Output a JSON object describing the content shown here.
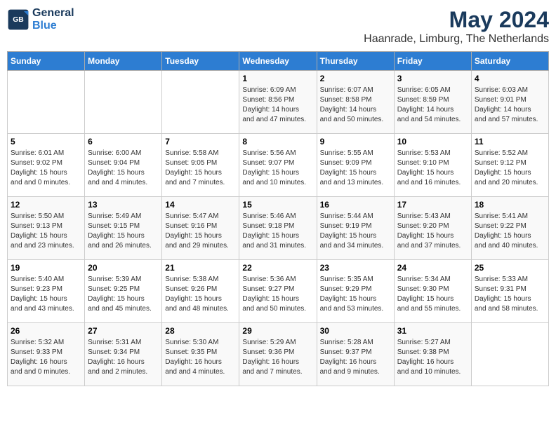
{
  "header": {
    "logo_general": "General",
    "logo_blue": "Blue",
    "month": "May 2024",
    "location": "Haanrade, Limburg, The Netherlands"
  },
  "weekdays": [
    "Sunday",
    "Monday",
    "Tuesday",
    "Wednesday",
    "Thursday",
    "Friday",
    "Saturday"
  ],
  "weeks": [
    [
      {
        "day": "",
        "sunrise": "",
        "sunset": "",
        "daylight": ""
      },
      {
        "day": "",
        "sunrise": "",
        "sunset": "",
        "daylight": ""
      },
      {
        "day": "",
        "sunrise": "",
        "sunset": "",
        "daylight": ""
      },
      {
        "day": "1",
        "sunrise": "Sunrise: 6:09 AM",
        "sunset": "Sunset: 8:56 PM",
        "daylight": "Daylight: 14 hours and 47 minutes."
      },
      {
        "day": "2",
        "sunrise": "Sunrise: 6:07 AM",
        "sunset": "Sunset: 8:58 PM",
        "daylight": "Daylight: 14 hours and 50 minutes."
      },
      {
        "day": "3",
        "sunrise": "Sunrise: 6:05 AM",
        "sunset": "Sunset: 8:59 PM",
        "daylight": "Daylight: 14 hours and 54 minutes."
      },
      {
        "day": "4",
        "sunrise": "Sunrise: 6:03 AM",
        "sunset": "Sunset: 9:01 PM",
        "daylight": "Daylight: 14 hours and 57 minutes."
      }
    ],
    [
      {
        "day": "5",
        "sunrise": "Sunrise: 6:01 AM",
        "sunset": "Sunset: 9:02 PM",
        "daylight": "Daylight: 15 hours and 0 minutes."
      },
      {
        "day": "6",
        "sunrise": "Sunrise: 6:00 AM",
        "sunset": "Sunset: 9:04 PM",
        "daylight": "Daylight: 15 hours and 4 minutes."
      },
      {
        "day": "7",
        "sunrise": "Sunrise: 5:58 AM",
        "sunset": "Sunset: 9:05 PM",
        "daylight": "Daylight: 15 hours and 7 minutes."
      },
      {
        "day": "8",
        "sunrise": "Sunrise: 5:56 AM",
        "sunset": "Sunset: 9:07 PM",
        "daylight": "Daylight: 15 hours and 10 minutes."
      },
      {
        "day": "9",
        "sunrise": "Sunrise: 5:55 AM",
        "sunset": "Sunset: 9:09 PM",
        "daylight": "Daylight: 15 hours and 13 minutes."
      },
      {
        "day": "10",
        "sunrise": "Sunrise: 5:53 AM",
        "sunset": "Sunset: 9:10 PM",
        "daylight": "Daylight: 15 hours and 16 minutes."
      },
      {
        "day": "11",
        "sunrise": "Sunrise: 5:52 AM",
        "sunset": "Sunset: 9:12 PM",
        "daylight": "Daylight: 15 hours and 20 minutes."
      }
    ],
    [
      {
        "day": "12",
        "sunrise": "Sunrise: 5:50 AM",
        "sunset": "Sunset: 9:13 PM",
        "daylight": "Daylight: 15 hours and 23 minutes."
      },
      {
        "day": "13",
        "sunrise": "Sunrise: 5:49 AM",
        "sunset": "Sunset: 9:15 PM",
        "daylight": "Daylight: 15 hours and 26 minutes."
      },
      {
        "day": "14",
        "sunrise": "Sunrise: 5:47 AM",
        "sunset": "Sunset: 9:16 PM",
        "daylight": "Daylight: 15 hours and 29 minutes."
      },
      {
        "day": "15",
        "sunrise": "Sunrise: 5:46 AM",
        "sunset": "Sunset: 9:18 PM",
        "daylight": "Daylight: 15 hours and 31 minutes."
      },
      {
        "day": "16",
        "sunrise": "Sunrise: 5:44 AM",
        "sunset": "Sunset: 9:19 PM",
        "daylight": "Daylight: 15 hours and 34 minutes."
      },
      {
        "day": "17",
        "sunrise": "Sunrise: 5:43 AM",
        "sunset": "Sunset: 9:20 PM",
        "daylight": "Daylight: 15 hours and 37 minutes."
      },
      {
        "day": "18",
        "sunrise": "Sunrise: 5:41 AM",
        "sunset": "Sunset: 9:22 PM",
        "daylight": "Daylight: 15 hours and 40 minutes."
      }
    ],
    [
      {
        "day": "19",
        "sunrise": "Sunrise: 5:40 AM",
        "sunset": "Sunset: 9:23 PM",
        "daylight": "Daylight: 15 hours and 43 minutes."
      },
      {
        "day": "20",
        "sunrise": "Sunrise: 5:39 AM",
        "sunset": "Sunset: 9:25 PM",
        "daylight": "Daylight: 15 hours and 45 minutes."
      },
      {
        "day": "21",
        "sunrise": "Sunrise: 5:38 AM",
        "sunset": "Sunset: 9:26 PM",
        "daylight": "Daylight: 15 hours and 48 minutes."
      },
      {
        "day": "22",
        "sunrise": "Sunrise: 5:36 AM",
        "sunset": "Sunset: 9:27 PM",
        "daylight": "Daylight: 15 hours and 50 minutes."
      },
      {
        "day": "23",
        "sunrise": "Sunrise: 5:35 AM",
        "sunset": "Sunset: 9:29 PM",
        "daylight": "Daylight: 15 hours and 53 minutes."
      },
      {
        "day": "24",
        "sunrise": "Sunrise: 5:34 AM",
        "sunset": "Sunset: 9:30 PM",
        "daylight": "Daylight: 15 hours and 55 minutes."
      },
      {
        "day": "25",
        "sunrise": "Sunrise: 5:33 AM",
        "sunset": "Sunset: 9:31 PM",
        "daylight": "Daylight: 15 hours and 58 minutes."
      }
    ],
    [
      {
        "day": "26",
        "sunrise": "Sunrise: 5:32 AM",
        "sunset": "Sunset: 9:33 PM",
        "daylight": "Daylight: 16 hours and 0 minutes."
      },
      {
        "day": "27",
        "sunrise": "Sunrise: 5:31 AM",
        "sunset": "Sunset: 9:34 PM",
        "daylight": "Daylight: 16 hours and 2 minutes."
      },
      {
        "day": "28",
        "sunrise": "Sunrise: 5:30 AM",
        "sunset": "Sunset: 9:35 PM",
        "daylight": "Daylight: 16 hours and 4 minutes."
      },
      {
        "day": "29",
        "sunrise": "Sunrise: 5:29 AM",
        "sunset": "Sunset: 9:36 PM",
        "daylight": "Daylight: 16 hours and 7 minutes."
      },
      {
        "day": "30",
        "sunrise": "Sunrise: 5:28 AM",
        "sunset": "Sunset: 9:37 PM",
        "daylight": "Daylight: 16 hours and 9 minutes."
      },
      {
        "day": "31",
        "sunrise": "Sunrise: 5:27 AM",
        "sunset": "Sunset: 9:38 PM",
        "daylight": "Daylight: 16 hours and 10 minutes."
      },
      {
        "day": "",
        "sunrise": "",
        "sunset": "",
        "daylight": ""
      }
    ]
  ]
}
